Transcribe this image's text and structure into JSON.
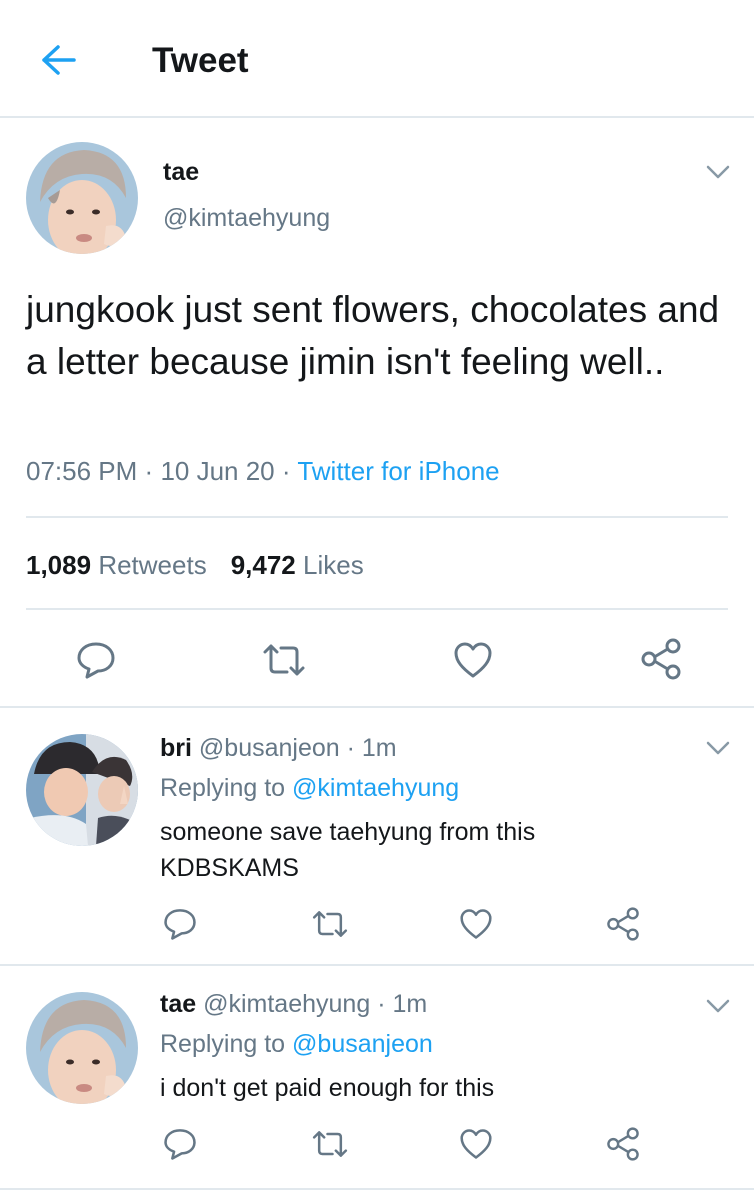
{
  "header": {
    "title": "Tweet"
  },
  "main_tweet": {
    "name": "tae",
    "handle": "@kimtaehyung",
    "text": "jungkook just sent flowers, chocolates and a letter because jimin isn't feeling well..",
    "time": "07:56 PM",
    "separator": "·",
    "date": "10 Jun 20",
    "source": "Twitter for iPhone",
    "retweets_count": "1,089",
    "retweets_label": "Retweets",
    "likes_count": "9,472",
    "likes_label": "Likes"
  },
  "replies": [
    {
      "name": "bri",
      "handle": "@busanjeon",
      "separator": "·",
      "time": "1m",
      "replying_label": "Replying to",
      "replying_to": "@kimtaehyung",
      "text_line1": "someone save taehyung from this",
      "text_line2": "KDBSKAMS"
    },
    {
      "name": "tae",
      "handle": "@kimtaehyung",
      "separator": "·",
      "time": "1m",
      "replying_label": "Replying to",
      "replying_to": "@busanjeon",
      "text_line1": "i don't get paid enough for this"
    }
  ],
  "icons": {
    "back": "arrow-left-icon",
    "reply": "speech-bubble-icon",
    "retweet": "retweet-icon",
    "like": "heart-icon",
    "share": "share-icon",
    "caret": "chevron-down-icon"
  },
  "colors": {
    "accent": "#1da1f2",
    "text": "#14171a",
    "secondary": "#657786",
    "divider": "#e1e8ed",
    "icon": "#657786"
  }
}
